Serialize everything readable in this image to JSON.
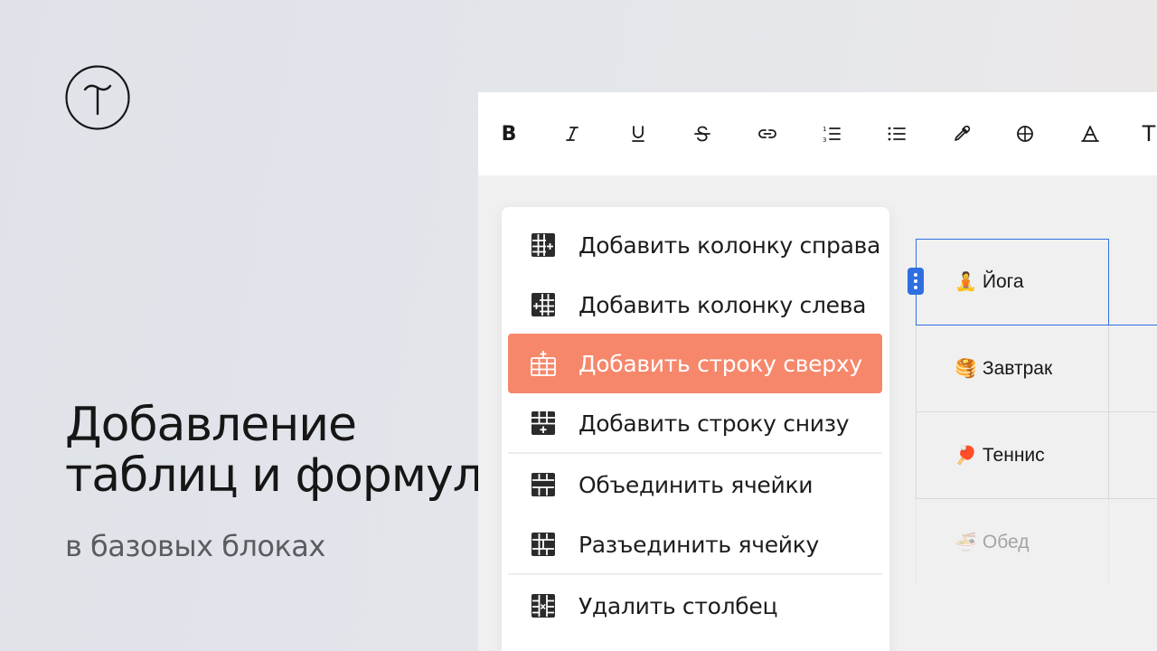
{
  "brand": {
    "logo_icon": "tilda-logo-icon"
  },
  "headline": {
    "line1": "Добавление",
    "line2": "таблиц и формул"
  },
  "subline": "в базовых блоках",
  "toolbar": {
    "tools": [
      "bold-icon",
      "italic-icon",
      "underline-icon",
      "strikethrough-icon",
      "link-icon",
      "ordered-list-icon",
      "bullet-list-icon",
      "color-picker-icon",
      "globe-icon",
      "font-color-icon",
      "text-size-icon"
    ],
    "bold_glyph": "B",
    "text_glyph": "T"
  },
  "table": {
    "rows": [
      {
        "emoji": "🧘",
        "label": "Йога"
      },
      {
        "emoji": "🥞",
        "label": "Завтрак"
      },
      {
        "emoji": "🏓",
        "label": "Теннис"
      },
      {
        "emoji": "🍜",
        "label": "Обед"
      }
    ]
  },
  "menu": {
    "items": [
      {
        "label": "Добавить колонку справа",
        "icon": "add-column-right-icon"
      },
      {
        "label": "Добавить колонку слева",
        "icon": "add-column-left-icon"
      },
      {
        "label": "Добавить строку сверху",
        "icon": "add-row-above-icon",
        "active": true
      },
      {
        "label": "Добавить строку снизу",
        "icon": "add-row-below-icon"
      },
      {
        "label": "Объединить ячейки",
        "icon": "merge-cells-icon"
      },
      {
        "label": "Разъединить ячейку",
        "icon": "split-cell-icon"
      },
      {
        "label": "Удалить столбец",
        "icon": "delete-column-icon"
      }
    ]
  },
  "colors": {
    "accent": "#f6876b",
    "selection": "#2f6fe0",
    "text": "#161616"
  }
}
